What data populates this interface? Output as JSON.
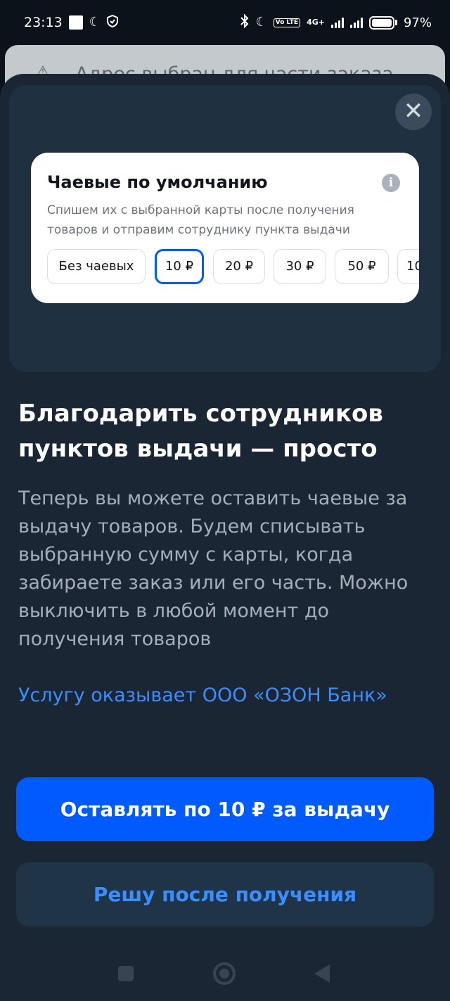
{
  "status_bar": {
    "time": "23:13",
    "network": "4G+",
    "volte": "Vo LTE",
    "battery_percent": "97%",
    "icons": [
      "notification-square-icon",
      "moon-clock-icon",
      "shield-check-icon",
      "bluetooth-icon",
      "do-not-disturb-moon-icon",
      "signal-icon",
      "battery-icon"
    ]
  },
  "underlay": {
    "text": "Адрес выбран для части заказа",
    "icon": "warning-icon"
  },
  "banner": {
    "close_icon": "close-icon",
    "close_glyph": "✕",
    "card_title": "Чаевые по умолчанию",
    "info_icon": "info-icon",
    "info_glyph": "i",
    "card_description": "Спишем их с выбранной карты после получения товаров и отправим сотруднику пункта выдачи",
    "options": [
      "Без чаевых",
      "10 ₽",
      "20 ₽",
      "30 ₽",
      "50 ₽",
      "10"
    ],
    "selected_option": "10 ₽"
  },
  "headline": "Благодарить сотрудников пунктов выдачи — просто",
  "body": "Теперь вы можете оставить чаевые за выдачу товаров. Будем списывать выбранную сумму с карты, когда забираете заказ или его часть. Можно выключить в любой момент до получения товаров",
  "bank_link": "Услугу оказывает ООО «ОЗОН Банк»",
  "primary_button": "Оставлять по 10 ₽ за выдачу",
  "secondary_button": "Решу после получения",
  "colors": {
    "accent": "#005bff",
    "link": "#3c8dff",
    "sheet_background": "#1b2634"
  }
}
